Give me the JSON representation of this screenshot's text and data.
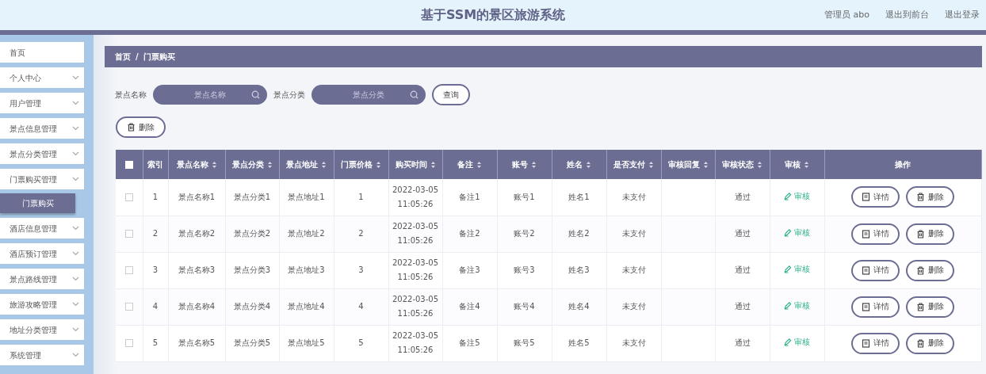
{
  "header": {
    "title": "基于SSM的景区旅游系统",
    "links": [
      "管理员 abo",
      "退出到前台",
      "退出登录"
    ]
  },
  "sidebar": {
    "items": [
      {
        "label": "首页",
        "expandable": false
      },
      {
        "label": "个人中心",
        "expandable": true
      },
      {
        "label": "用户管理",
        "expandable": true
      },
      {
        "label": "景点信息管理",
        "expandable": true
      },
      {
        "label": "景点分类管理",
        "expandable": true
      },
      {
        "label": "门票购买管理",
        "expandable": true,
        "children": [
          {
            "label": "门票购买",
            "selected": true
          }
        ]
      },
      {
        "label": "酒店信息管理",
        "expandable": true
      },
      {
        "label": "酒店预订管理",
        "expandable": true
      },
      {
        "label": "景点路线管理",
        "expandable": true
      },
      {
        "label": "旅游攻略管理",
        "expandable": true
      },
      {
        "label": "地址分类管理",
        "expandable": true
      },
      {
        "label": "系统管理",
        "expandable": true
      }
    ]
  },
  "breadcrumb": {
    "items": [
      "首页",
      "门票购买"
    ],
    "separator": "/"
  },
  "search": {
    "fields": [
      {
        "label": "景点名称",
        "placeholder": "景点名称"
      },
      {
        "label": "景点分类",
        "placeholder": "景点分类"
      }
    ],
    "button": "查询"
  },
  "delete_button": "删除",
  "table": {
    "select_all_checked": false,
    "columns": [
      {
        "label": "索引",
        "sortable": false
      },
      {
        "label": "景点名称",
        "sortable": true
      },
      {
        "label": "景点分类",
        "sortable": true
      },
      {
        "label": "景点地址",
        "sortable": true
      },
      {
        "label": "门票价格",
        "sortable": true
      },
      {
        "label": "购买时间",
        "sortable": true
      },
      {
        "label": "备注",
        "sortable": true
      },
      {
        "label": "账号",
        "sortable": true
      },
      {
        "label": "姓名",
        "sortable": true
      },
      {
        "label": "是否支付",
        "sortable": true
      },
      {
        "label": "审核回复",
        "sortable": true
      },
      {
        "label": "审核状态",
        "sortable": true
      },
      {
        "label": "审核",
        "sortable": true
      },
      {
        "label": "操作",
        "sortable": false
      }
    ],
    "rows": [
      {
        "checked": false,
        "cells": [
          "1",
          "景点名称1",
          "景点分类1",
          "景点地址1",
          "1",
          [
            "2022-03-05",
            "11:05:26"
          ],
          "备注1",
          "账号1",
          "姓名1",
          "未支付",
          "",
          "通过"
        ],
        "review": "审核",
        "actions": [
          "详情",
          "删除"
        ]
      },
      {
        "checked": false,
        "cells": [
          "2",
          "景点名称2",
          "景点分类2",
          "景点地址2",
          "2",
          [
            "2022-03-05",
            "11:05:26"
          ],
          "备注2",
          "账号2",
          "姓名2",
          "未支付",
          "",
          "通过"
        ],
        "review": "审核",
        "actions": [
          "详情",
          "删除"
        ]
      },
      {
        "checked": false,
        "cells": [
          "3",
          "景点名称3",
          "景点分类3",
          "景点地址3",
          "3",
          [
            "2022-03-05",
            "11:05:26"
          ],
          "备注3",
          "账号3",
          "姓名3",
          "未支付",
          "",
          "通过"
        ],
        "review": "审核",
        "actions": [
          "详情",
          "删除"
        ]
      },
      {
        "checked": false,
        "cells": [
          "4",
          "景点名称4",
          "景点分类4",
          "景点地址4",
          "4",
          [
            "2022-03-05",
            "11:05:26"
          ],
          "备注4",
          "账号4",
          "姓名4",
          "未支付",
          "",
          "通过"
        ],
        "review": "审核",
        "actions": [
          "详情",
          "删除"
        ]
      },
      {
        "checked": false,
        "cells": [
          "5",
          "景点名称5",
          "景点分类5",
          "景点地址5",
          "5",
          [
            "2022-03-05",
            "11:05:26"
          ],
          "备注5",
          "账号5",
          "姓名5",
          "未支付",
          "",
          "通过"
        ],
        "review": "审核",
        "actions": [
          "详情",
          "删除"
        ]
      }
    ]
  }
}
